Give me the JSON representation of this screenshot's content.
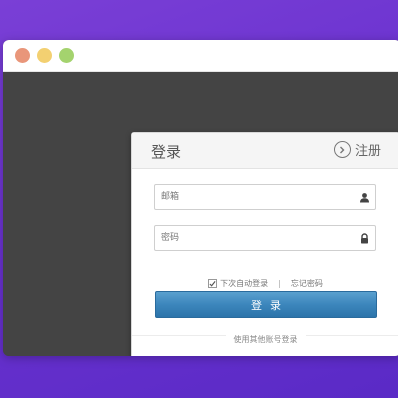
{
  "window": {
    "controls": {
      "close_color": "#e9967a",
      "minimize_color": "#f3d071",
      "maximize_color": "#a4d36e"
    }
  },
  "login": {
    "title": "登录",
    "register_label": "注册",
    "email_placeholder": "邮箱",
    "password_placeholder": "密码",
    "remember_label": "下次自动登录",
    "remember_checked": true,
    "separator": "|",
    "forgot_label": "忘记密码",
    "submit_label": "登录",
    "other_login_label": "使用其他账号登录"
  },
  "icons": {
    "register": "circle-arrow-right-icon",
    "email": "user-icon",
    "password": "lock-icon",
    "remember": "check-icon"
  },
  "colors": {
    "background": "#6a32cf",
    "window_content": "#444444",
    "button": "#3c86bc"
  }
}
